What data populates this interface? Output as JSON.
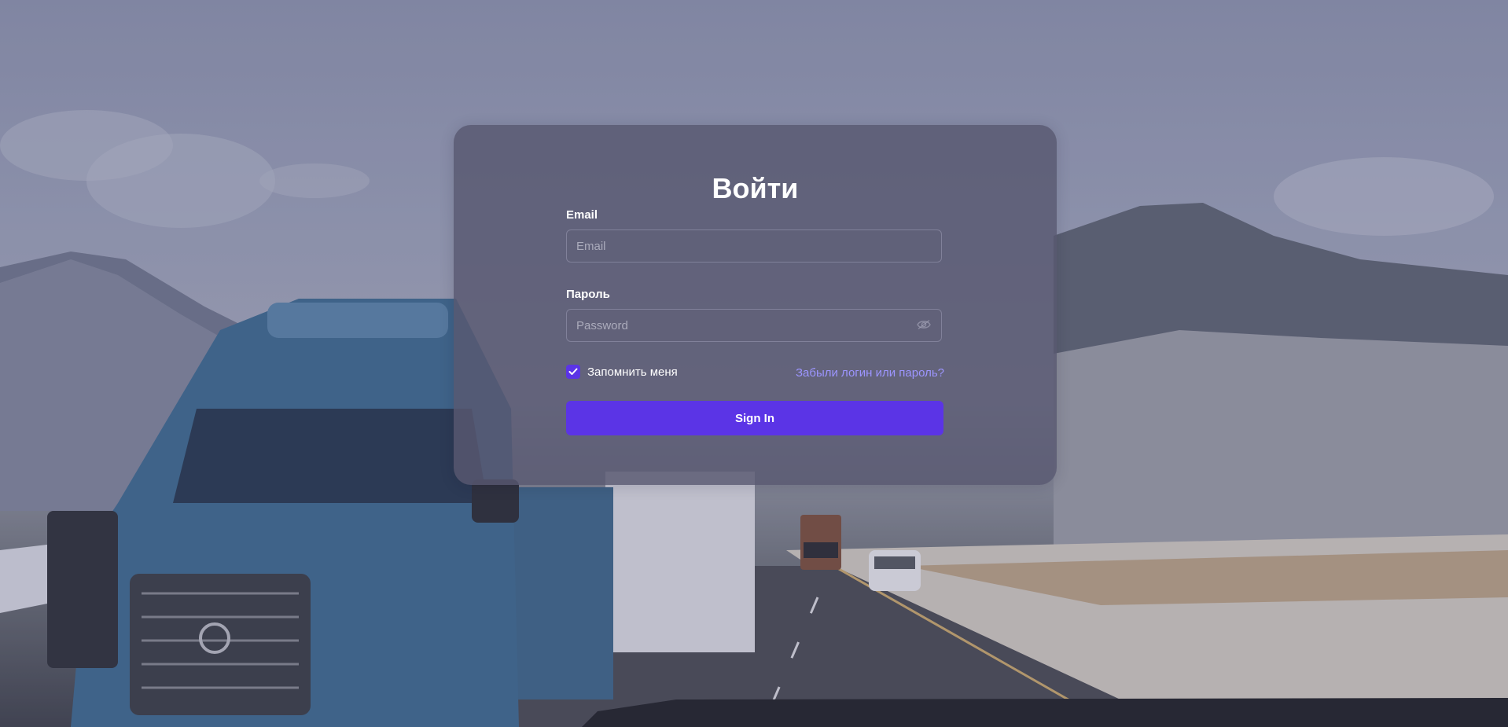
{
  "colors": {
    "accent": "#5b34e6",
    "link": "#9c95ff",
    "card_background": "#585870",
    "text": "#ffffff"
  },
  "background": {
    "icon": "landscape-photo-truck-highway-mountains"
  },
  "login": {
    "title": "Войти",
    "email_label": "Email",
    "email_value": "",
    "email_placeholder": "Email",
    "password_label": "Пароль",
    "password_value": "",
    "password_placeholder": "Password",
    "password_toggle_icon": "eye-icon",
    "remember_label": "Запомнить меня",
    "remember_checked": true,
    "forgot_link": "Забыли логин или пароль?",
    "submit_label": "Sign In"
  }
}
